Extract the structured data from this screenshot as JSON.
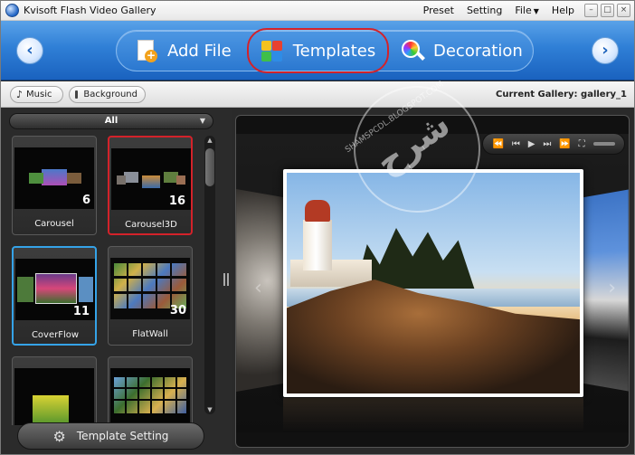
{
  "window": {
    "title": "Kvisoft Flash Video Gallery",
    "menu": [
      {
        "label": "Preset",
        "has_caret": false
      },
      {
        "label": "Setting",
        "has_caret": false
      },
      {
        "label": "File",
        "has_caret": true
      },
      {
        "label": "Help",
        "has_caret": false
      }
    ],
    "controls": {
      "minimize": "–",
      "maximize": "□",
      "close": "×"
    }
  },
  "toolbar": {
    "prev_icon": "‹",
    "next_icon": "›",
    "buttons": [
      {
        "label": "Add File",
        "icon": "add-file-icon"
      },
      {
        "label": "Templates",
        "icon": "templates-icon",
        "highlighted": true
      },
      {
        "label": "Decoration",
        "icon": "decoration-icon"
      }
    ]
  },
  "subbar": {
    "music_label": "Music",
    "background_label": "Background",
    "current_gallery": "Current Gallery: gallery_1"
  },
  "templates": {
    "filter": "All",
    "items": [
      {
        "name": "Carousel",
        "count": "6"
      },
      {
        "name": "Carousel3D",
        "count": "16",
        "selected_red": true
      },
      {
        "name": "CoverFlow",
        "count": "11",
        "selected_blue": true
      },
      {
        "name": "FlatWall",
        "count": "30"
      },
      {
        "name": "",
        "count": ""
      },
      {
        "name": "",
        "count": ""
      }
    ],
    "setting_label": "Template Setting"
  },
  "player": {
    "controls": [
      "⏪",
      "⏮",
      "▶",
      "⏭",
      "⏩",
      "⛶"
    ]
  },
  "watermark": {
    "text": "SHAMSPCDL.BLOGSPOT.COM",
    "glyph": "شرح"
  },
  "colors": {
    "toolbar_blue": "#2f7fd6",
    "highlight_red": "#d3222a",
    "selected_blue": "#35a3e8"
  }
}
